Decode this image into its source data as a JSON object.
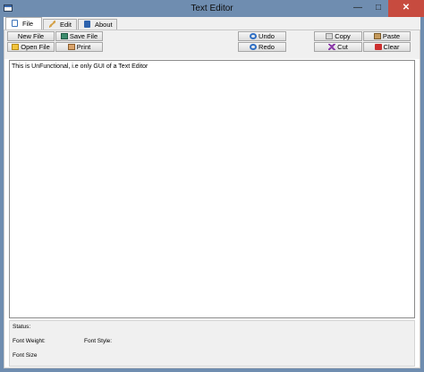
{
  "window": {
    "title": "Text Editor"
  },
  "tabs": [
    {
      "label": "File",
      "icon": "file-icon",
      "active": true
    },
    {
      "label": "Edit",
      "icon": "edit-icon",
      "active": false
    },
    {
      "label": "About",
      "icon": "about-icon",
      "active": false
    }
  ],
  "toolbar": {
    "new_file": "New File",
    "save_file": "Save File",
    "open_file": "Open File",
    "print": "Print",
    "undo": "Undo",
    "redo": "Redo",
    "copy": "Copy",
    "paste": "Paste",
    "cut": "Cut",
    "clear": "Clear"
  },
  "editor": {
    "text": "This is UnFunctional, i.e only GUI of a Text Editor"
  },
  "status": {
    "status_label": "Status:",
    "font_weight_label": "Font Weight:",
    "font_style_label": "Font Style:",
    "font_size_label": "Font Size"
  },
  "colors": {
    "titlebar": "#6f8db0",
    "close_button": "#c74b3f",
    "panel": "#f0f0f0"
  }
}
